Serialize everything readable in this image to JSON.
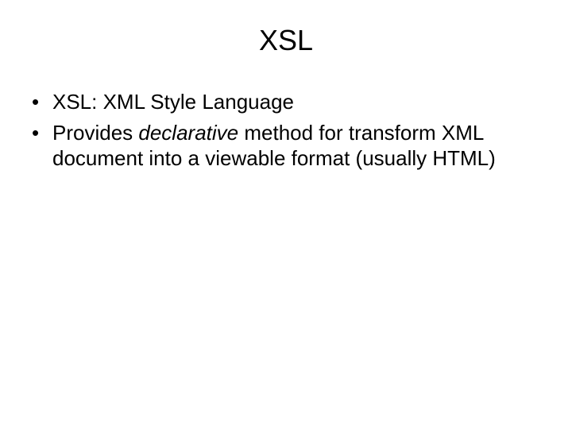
{
  "slide": {
    "title": "XSL",
    "bullets": [
      {
        "text": "XSL: XML Style Language"
      },
      {
        "pre": "Provides ",
        "em": "declarative",
        "post": " method for transform XML document into a viewable format (usually HTML)"
      }
    ]
  }
}
